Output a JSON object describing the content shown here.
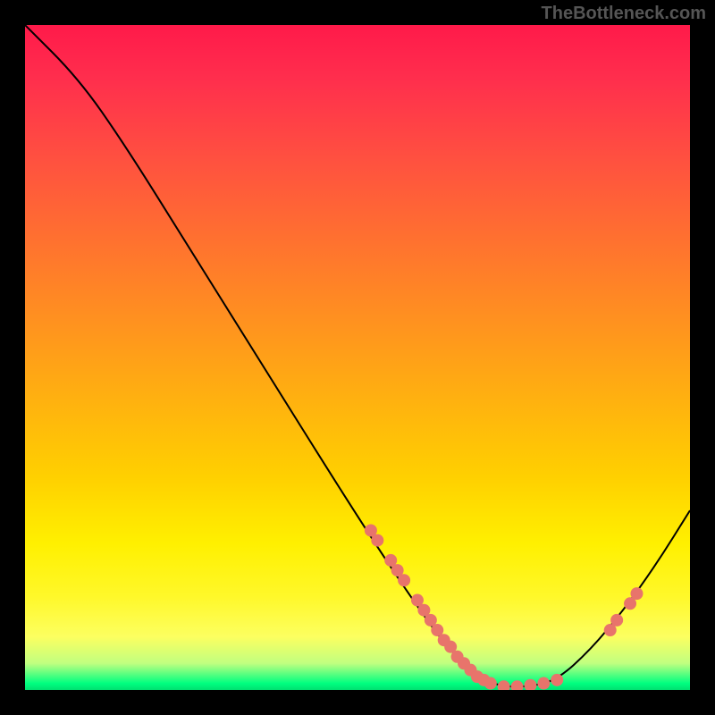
{
  "watermark": "TheBottleneck.com",
  "chart_data": {
    "type": "line",
    "title": "",
    "xlabel": "",
    "ylabel": "",
    "xlim": [
      0,
      100
    ],
    "ylim": [
      0,
      100
    ],
    "curve_points": [
      {
        "x": 0,
        "y": 100
      },
      {
        "x": 8,
        "y": 92
      },
      {
        "x": 15,
        "y": 82
      },
      {
        "x": 25,
        "y": 66
      },
      {
        "x": 35,
        "y": 50
      },
      {
        "x": 45,
        "y": 34
      },
      {
        "x": 52,
        "y": 23
      },
      {
        "x": 58,
        "y": 14
      },
      {
        "x": 63,
        "y": 7
      },
      {
        "x": 67,
        "y": 3
      },
      {
        "x": 71,
        "y": 0.5
      },
      {
        "x": 76,
        "y": 0.5
      },
      {
        "x": 80,
        "y": 1.5
      },
      {
        "x": 85,
        "y": 6
      },
      {
        "x": 90,
        "y": 12
      },
      {
        "x": 95,
        "y": 19
      },
      {
        "x": 100,
        "y": 27
      }
    ],
    "scatter_points": [
      {
        "x": 52,
        "y": 24
      },
      {
        "x": 53,
        "y": 22.5
      },
      {
        "x": 55,
        "y": 19.5
      },
      {
        "x": 56,
        "y": 18
      },
      {
        "x": 57,
        "y": 16.5
      },
      {
        "x": 59,
        "y": 13.5
      },
      {
        "x": 60,
        "y": 12
      },
      {
        "x": 61,
        "y": 10.5
      },
      {
        "x": 62,
        "y": 9
      },
      {
        "x": 63,
        "y": 7.5
      },
      {
        "x": 64,
        "y": 6.5
      },
      {
        "x": 65,
        "y": 5
      },
      {
        "x": 66,
        "y": 4
      },
      {
        "x": 67,
        "y": 3
      },
      {
        "x": 68,
        "y": 2
      },
      {
        "x": 69,
        "y": 1.5
      },
      {
        "x": 70,
        "y": 1
      },
      {
        "x": 72,
        "y": 0.5
      },
      {
        "x": 74,
        "y": 0.5
      },
      {
        "x": 76,
        "y": 0.7
      },
      {
        "x": 78,
        "y": 1
      },
      {
        "x": 80,
        "y": 1.5
      },
      {
        "x": 88,
        "y": 9
      },
      {
        "x": 89,
        "y": 10.5
      },
      {
        "x": 91,
        "y": 13
      },
      {
        "x": 92,
        "y": 14.5
      }
    ]
  },
  "colors": {
    "gradient_top": "#ff1a4a",
    "gradient_bottom": "#00e070",
    "curve": "#000000",
    "points": "#e8746b",
    "background": "#000000"
  }
}
